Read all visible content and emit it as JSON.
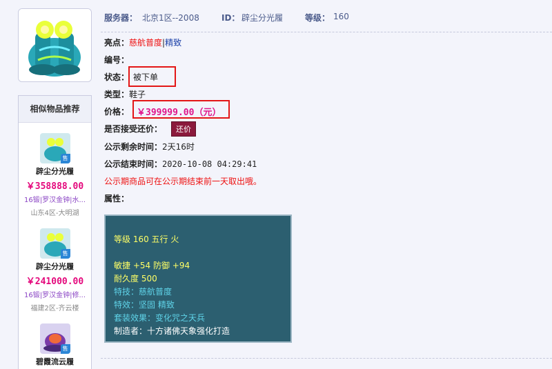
{
  "header": {
    "server_label": "服务器：",
    "server_value": "北京1区--2008",
    "id_label": "ID：",
    "id_value": "辟尘分光履",
    "level_label": "等级：",
    "level_value": "160"
  },
  "details": {
    "highlight_label": "亮点：",
    "highlight_value_1": "慈航普度",
    "highlight_sep": "|",
    "highlight_value_2": "精致",
    "number_label": "编号：",
    "status_label": "状态：",
    "status_value": "被下单",
    "type_label": "类型：",
    "type_value": "鞋子",
    "price_label": "价格：",
    "price_value": "￥399999.00（元）",
    "counter_label": "是否接受还价：",
    "counter_button": "还价",
    "remain_label": "公示剩余时间：",
    "remain_value": "2天16时",
    "end_label": "公示结束时间：",
    "end_value": "2020-10-08 04:29:41",
    "notice": "公示期商品可在公示期结束前一天取出哦。",
    "attr_label": "属性："
  },
  "attributes": {
    "line1": "等级 160 五行 火",
    "line2": "敏捷 +54 防御 +94",
    "line3": "耐久度 500",
    "line4": "特技：慈航普度",
    "line5": "特效：坚固 精致",
    "line6": "套装效果：变化咒之天兵",
    "line7": "制造者：十方诸佛天象强化打造"
  },
  "similar": {
    "title": "相似物品推荐",
    "items": [
      {
        "name": "辟尘分光履",
        "price": "￥358888.00",
        "tags": "16锻|罗汉金钟|水...",
        "server": "山东4区-大明湖",
        "badge": "售"
      },
      {
        "name": "辟尘分光履",
        "price": "￥241000.00",
        "tags": "16锻|罗汉金钟|修...",
        "server": "福建2区-齐云楼",
        "badge": "售"
      },
      {
        "name": "碧霞流云履",
        "badge": "售"
      }
    ]
  },
  "colors": {
    "accent_pink": "#e0158a",
    "highlight_red": "#e31515",
    "panel_bg": "#2c5f70",
    "counter_button_bg": "#8b1a3c"
  }
}
